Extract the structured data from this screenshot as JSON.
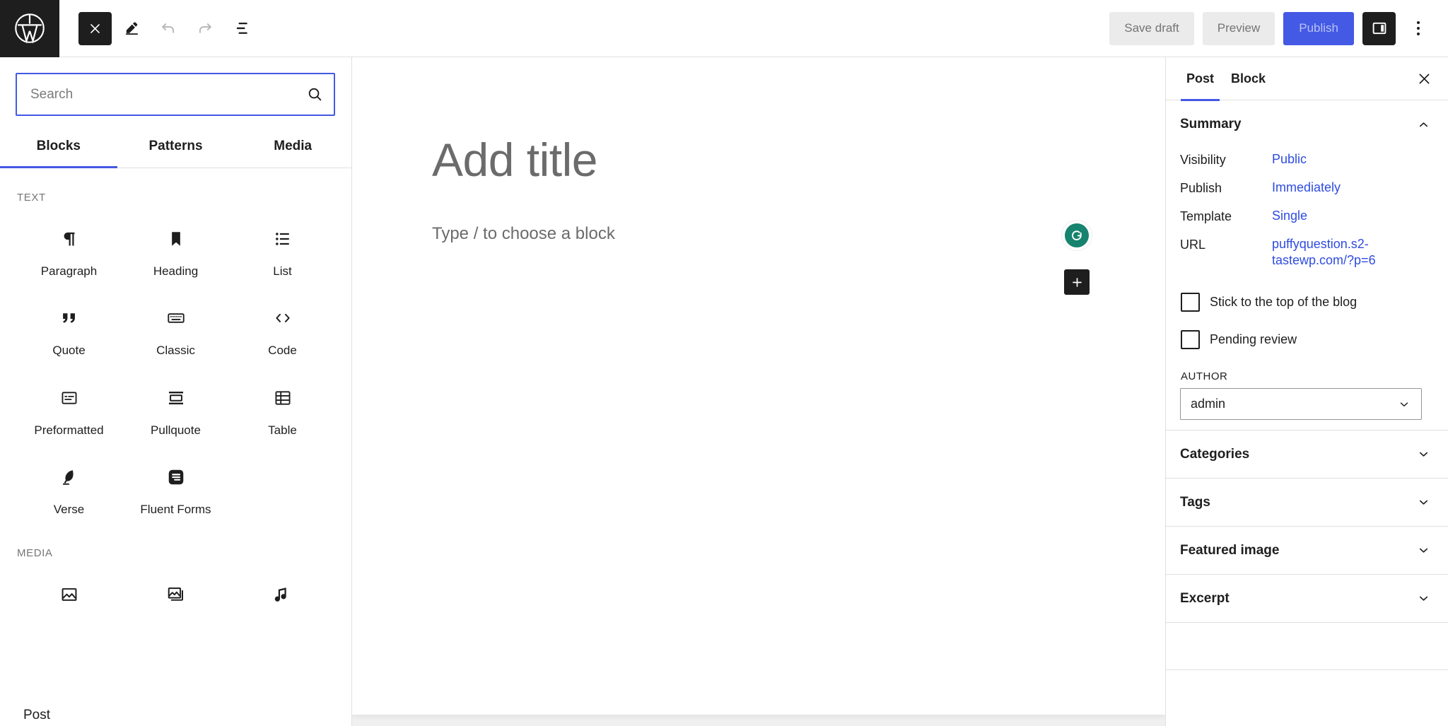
{
  "topbar": {
    "logo_icon": "wordpress-icon",
    "close_icon": "close-icon",
    "edit_icon": "pencil-edit-icon",
    "undo_icon": "undo-arrow-icon",
    "redo_icon": "redo-arrow-icon",
    "listview_icon": "list-view-icon",
    "save_draft_label": "Save draft",
    "preview_label": "Preview",
    "publish_label": "Publish",
    "sidebar_toggle_icon": "settings-sidebar-icon",
    "options_icon": "more-options-vertical-dots-icon",
    "accent_color": "#4459e4",
    "dark_color": "#1e1e1e"
  },
  "inserter": {
    "search": {
      "value": "",
      "placeholder": "Search",
      "icon": "search-icon"
    },
    "tabs": [
      {
        "label": "Blocks",
        "active": true
      },
      {
        "label": "Patterns",
        "active": false
      },
      {
        "label": "Media",
        "active": false
      }
    ],
    "sections": [
      {
        "label": "TEXT",
        "blocks": [
          {
            "label": "Paragraph",
            "icon": "paragraph-pilcrow-icon"
          },
          {
            "label": "Heading",
            "icon": "heading-bookmark-icon"
          },
          {
            "label": "List",
            "icon": "list-icon"
          },
          {
            "label": "Quote",
            "icon": "quote-marks-icon"
          },
          {
            "label": "Classic",
            "icon": "classic-keyboard-icon"
          },
          {
            "label": "Code",
            "icon": "code-angle-brackets-icon"
          },
          {
            "label": "Preformatted",
            "icon": "preformatted-icon"
          },
          {
            "label": "Pullquote",
            "icon": "pullquote-icon"
          },
          {
            "label": "Table",
            "icon": "table-grid-icon"
          },
          {
            "label": "Verse",
            "icon": "verse-feather-icon"
          },
          {
            "label": "Fluent Forms",
            "icon": "fluent-forms-icon"
          }
        ]
      },
      {
        "label": "MEDIA",
        "blocks": [
          {
            "label": "",
            "icon": "image-icon"
          },
          {
            "label": "",
            "icon": "gallery-icon"
          },
          {
            "label": "",
            "icon": "audio-note-icon"
          }
        ]
      }
    ],
    "footer_label": "Post"
  },
  "editor": {
    "title_placeholder": "Add title",
    "body_placeholder": "Type / to choose a block",
    "grammarly_icon": "grammarly-g-icon",
    "grammarly_color": "#15836d",
    "add_block_icon": "plus-icon"
  },
  "settings": {
    "tabs": [
      {
        "label": "Post",
        "active": true
      },
      {
        "label": "Block",
        "active": false
      }
    ],
    "close_icon": "close-icon",
    "summary": {
      "title": "Summary",
      "chevron_icon": "chevron-up-icon",
      "rows": [
        {
          "key": "Visibility",
          "value": "Public"
        },
        {
          "key": "Publish",
          "value": "Immediately"
        },
        {
          "key": "Template",
          "value": "Single"
        },
        {
          "key": "URL",
          "value": "puffyquestion.s2-tastewp.com/?p=6"
        }
      ],
      "checkboxes": [
        {
          "label": "Stick to the top of the blog",
          "checked": false
        },
        {
          "label": "Pending review",
          "checked": false
        }
      ],
      "author_label": "AUTHOR",
      "author_value": "admin",
      "author_chevron_icon": "chevron-down-icon"
    },
    "panels": [
      {
        "label": "Categories",
        "chevron_icon": "chevron-down-icon"
      },
      {
        "label": "Tags",
        "chevron_icon": "chevron-down-icon"
      },
      {
        "label": "Featured image",
        "chevron_icon": "chevron-down-icon"
      },
      {
        "label": "Excerpt",
        "chevron_icon": "chevron-down-icon"
      }
    ]
  }
}
